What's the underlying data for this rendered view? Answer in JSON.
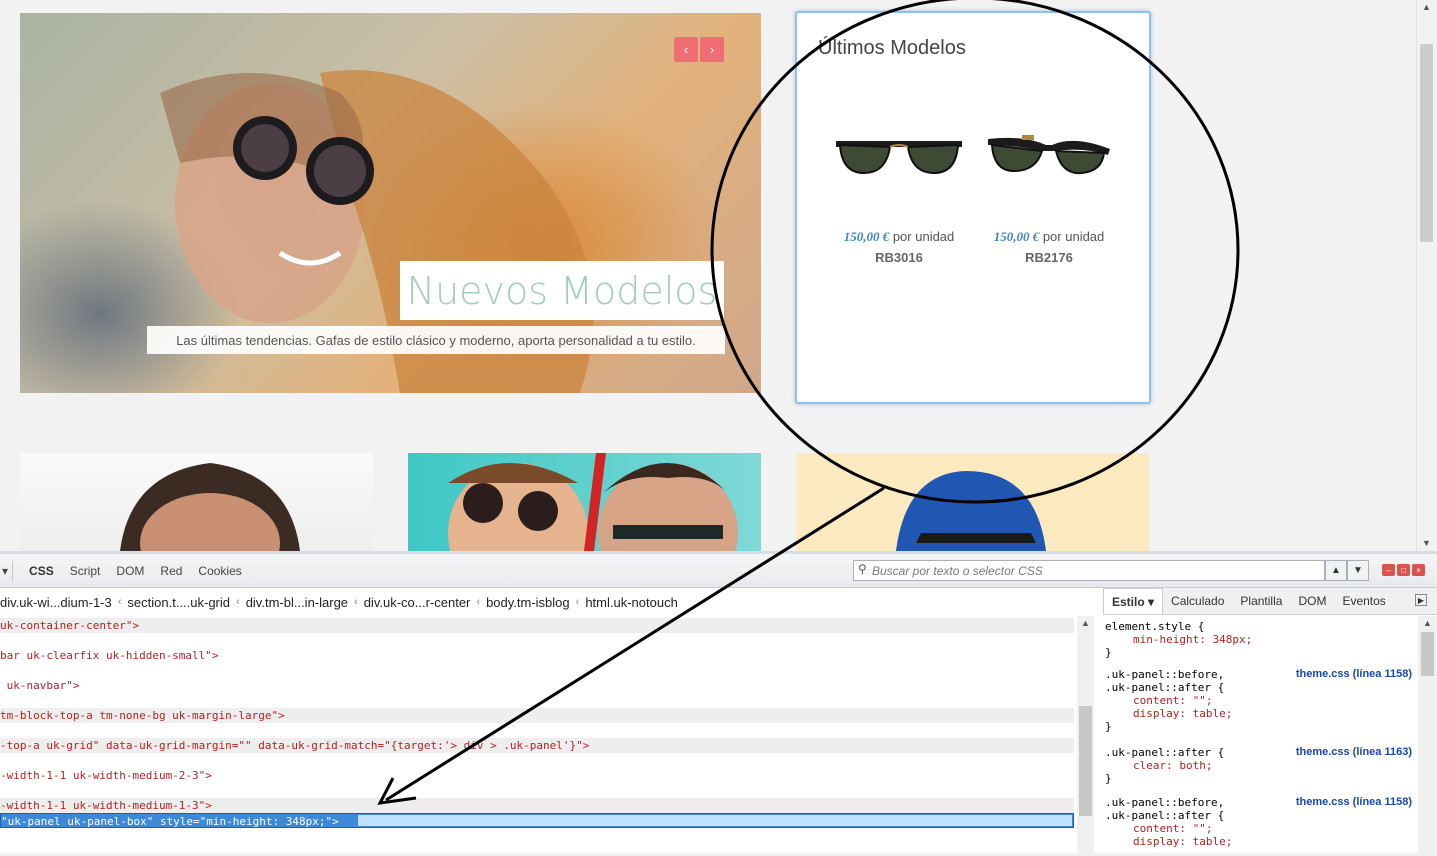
{
  "hero": {
    "title": "Nuevos Modelos",
    "subtitle": "Las últimas tendencias. Gafas de estilo clásico y moderno, aporta personalidad a tu estilo.",
    "prev": "‹",
    "next": "›"
  },
  "panel": {
    "title": "Últimos Modelos",
    "products": [
      {
        "price": "150,00 €",
        "unit": " por unidad",
        "name": "RB3016"
      },
      {
        "price": "150,00 €",
        "unit": " por unidad",
        "name": "RB2176"
      }
    ]
  },
  "devtools": {
    "menu_arrow": "▾",
    "tabs": [
      "CSS",
      "Script",
      "DOM",
      "Red",
      "Cookies"
    ],
    "search_placeholder": "Buscar por texto o selector CSS",
    "breadcrumbs": [
      "div.uk-wi...dium-1-3",
      "section.t....uk-grid",
      "div.tm-bl...in-large",
      "div.uk-co...r-center",
      "body.tm-isblog",
      "html.uk-notouch"
    ],
    "side_tabs": [
      "Estilo ▾",
      "Calculado",
      "Plantilla",
      "DOM",
      "Eventos"
    ],
    "html_lines": [
      "uk-container-center\">",
      "bar uk-clearfix uk-hidden-small\">",
      " uk-navbar\">",
      "tm-block-top-a tm-none-bg uk-margin-large\">",
      "-top-a uk-grid\" data-uk-grid-margin=\"\" data-uk-grid-match=\"{target:'> div > .uk-panel'}\">",
      "-width-1-1 uk-width-medium-2-3\">",
      "-width-1-1 uk-width-medium-1-3\">",
      "\"uk-panel uk-panel-box\" style=\"min-height: 348px;\">"
    ],
    "css_rules": [
      {
        "selector": [
          "element.style {"
        ],
        "props": [
          "min-height: 348px;"
        ],
        "source": ""
      },
      {
        "selector": [
          ".uk-panel::before,",
          ".uk-panel::after {"
        ],
        "props": [
          "content: \"\";",
          "display: table;"
        ],
        "source": "theme.css (línea 1158)"
      },
      {
        "selector": [
          ".uk-panel::after {"
        ],
        "props": [
          "clear: both;"
        ],
        "source": "theme.css (línea 1163)"
      },
      {
        "selector": [
          ".uk-panel::before,",
          ".uk-panel::after {"
        ],
        "props": [
          "content: \"\";",
          "display: table;"
        ],
        "source": "theme.css (línea 1158)"
      }
    ]
  },
  "colors": {
    "accent": "#ee6e73",
    "title_green": "#a3cdb6",
    "selection": "#3e88d8"
  }
}
